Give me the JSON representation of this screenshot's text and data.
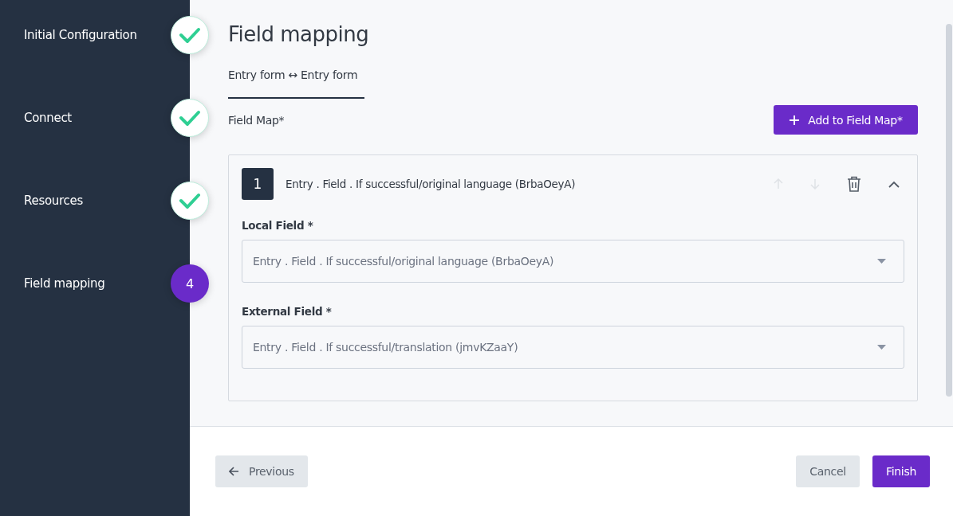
{
  "steps": [
    {
      "label": "Initial Configuration",
      "completed": true,
      "current": false
    },
    {
      "label": "Connect",
      "completed": true,
      "current": false
    },
    {
      "label": "Resources",
      "completed": true,
      "current": false
    },
    {
      "label": "Field mapping",
      "completed": false,
      "current": true,
      "number": "4"
    }
  ],
  "title": "Field mapping",
  "tabs": [
    {
      "label": "Entry form ↔ Entry form",
      "selected": true
    }
  ],
  "field_map": {
    "label": "Field Map*",
    "add_button": "Add to Field Map*",
    "mappings": [
      {
        "index": "1",
        "title": "Entry . Field . If successful/original language (BrbaOeyA)",
        "move_up_enabled": false,
        "move_down_enabled": false,
        "expanded": true,
        "fields": [
          {
            "label": "Local Field *",
            "value": "Entry . Field . If successful/original language (BrbaOeyA)"
          },
          {
            "label": "External Field *",
            "value": "Entry . Field . If successful/translation (jmvKZaaY)"
          }
        ]
      }
    ]
  },
  "footer": {
    "buttons": [
      {
        "kind": "back",
        "label": "Previous"
      },
      {
        "kind": "secondary",
        "label": "Cancel"
      },
      {
        "kind": "primary",
        "label": "Finish"
      }
    ]
  }
}
